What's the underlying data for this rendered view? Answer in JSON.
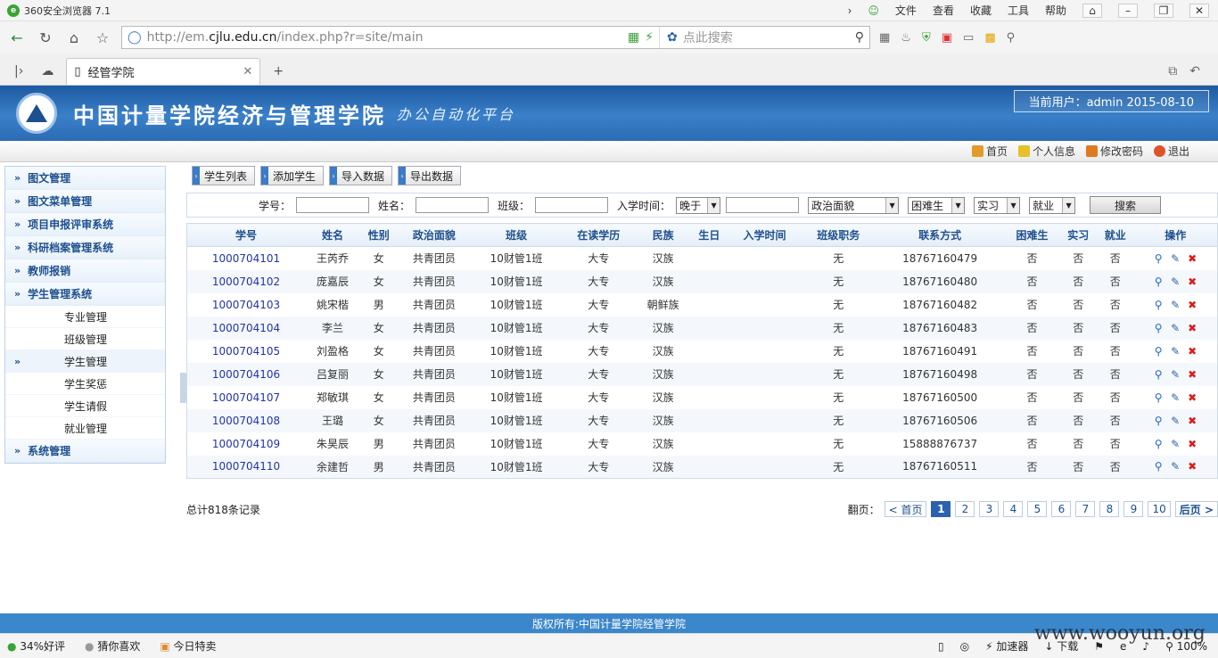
{
  "browser": {
    "title": "360安全浏览器 7.1",
    "menus": [
      "文件",
      "查看",
      "收藏",
      "工具",
      "帮助"
    ],
    "url_prefix": "http://em.",
    "url_host": "cjlu.edu.cn",
    "url_path": "/index.php?r=site/main",
    "search_placeholder": "点此搜索",
    "tab_title": "经管学院",
    "zoom": "100%"
  },
  "header": {
    "title": "中国计量学院经济与管理学院",
    "subtitle": "办公自动化平台",
    "current_user": "当前用户：admin 2015-08-10"
  },
  "topnav": [
    "首页",
    "个人信息",
    "修改密码",
    "退出"
  ],
  "sidebar": {
    "items": [
      {
        "label": "图文管理"
      },
      {
        "label": "图文菜单管理"
      },
      {
        "label": "项目申报评审系统"
      },
      {
        "label": "科研档案管理系统"
      },
      {
        "label": "教师报销"
      },
      {
        "label": "学生管理系统"
      }
    ],
    "subitems": [
      "专业管理",
      "班级管理",
      "学生管理",
      "学生奖惩",
      "学生请假",
      "就业管理"
    ],
    "last_item": "系统管理"
  },
  "actions": [
    "学生列表",
    "添加学生",
    "导入数据",
    "导出数据"
  ],
  "filter": {
    "id_label": "学号：",
    "name_label": "姓名：",
    "class_label": "班级：",
    "time_label": "入学时间：",
    "time_op": "晚于",
    "politics": "政治面貌",
    "hardship": "困难生",
    "internship": "实习",
    "employment": "就业",
    "search_button": "搜索"
  },
  "table": {
    "columns": [
      "学号",
      "姓名",
      "性别",
      "政治面貌",
      "班级",
      "在读学历",
      "民族",
      "生日",
      "入学时间",
      "班级职务",
      "联系方式",
      "困难生",
      "实习",
      "就业",
      "操作"
    ],
    "rows": [
      [
        "1000704101",
        "王芮乔",
        "女",
        "共青团员",
        "10财管1班",
        "大专",
        "汉族",
        "",
        "",
        "无",
        "18767160479",
        "否",
        "否",
        "否"
      ],
      [
        "1000704102",
        "庞嘉辰",
        "女",
        "共青团员",
        "10财管1班",
        "大专",
        "汉族",
        "",
        "",
        "无",
        "18767160480",
        "否",
        "否",
        "否"
      ],
      [
        "1000704103",
        "姚宋楷",
        "男",
        "共青团员",
        "10财管1班",
        "大专",
        "朝鲜族",
        "",
        "",
        "无",
        "18767160482",
        "否",
        "否",
        "否"
      ],
      [
        "1000704104",
        "李兰",
        "女",
        "共青团员",
        "10财管1班",
        "大专",
        "汉族",
        "",
        "",
        "无",
        "18767160483",
        "否",
        "否",
        "否"
      ],
      [
        "1000704105",
        "刘盈格",
        "女",
        "共青团员",
        "10财管1班",
        "大专",
        "汉族",
        "",
        "",
        "无",
        "18767160491",
        "否",
        "否",
        "否"
      ],
      [
        "1000704106",
        "吕复丽",
        "女",
        "共青团员",
        "10财管1班",
        "大专",
        "汉族",
        "",
        "",
        "无",
        "18767160498",
        "否",
        "否",
        "否"
      ],
      [
        "1000704107",
        "郑敏琪",
        "女",
        "共青团员",
        "10财管1班",
        "大专",
        "汉族",
        "",
        "",
        "无",
        "18767160500",
        "否",
        "否",
        "否"
      ],
      [
        "1000704108",
        "王璐",
        "女",
        "共青团员",
        "10财管1班",
        "大专",
        "汉族",
        "",
        "",
        "无",
        "18767160506",
        "否",
        "否",
        "否"
      ],
      [
        "1000704109",
        "朱昊辰",
        "男",
        "共青团员",
        "10财管1班",
        "大专",
        "汉族",
        "",
        "",
        "无",
        "15888876737",
        "否",
        "否",
        "否"
      ],
      [
        "1000704110",
        "余建哲",
        "男",
        "共青团员",
        "10财管1班",
        "大专",
        "汉族",
        "",
        "",
        "无",
        "18767160511",
        "否",
        "否",
        "否"
      ]
    ]
  },
  "total_text": "总计818条记录",
  "pager": {
    "label": "翻页：",
    "prev": "< 首页",
    "pages": [
      "1",
      "2",
      "3",
      "4",
      "5",
      "6",
      "7",
      "8",
      "9",
      "10"
    ],
    "current": "1",
    "next": "后页 >"
  },
  "copyright": "版权所有:中国计量学院经管学院",
  "statusbar": {
    "left": [
      "34%好评",
      "猜你喜欢",
      "今日特卖"
    ],
    "right": [
      "加速器",
      "下载"
    ]
  },
  "watermark": "www.wooyun.org",
  "colors": {
    "accent": "#2a62ad",
    "banner": "#3a80c9",
    "link": "#2233aa"
  }
}
